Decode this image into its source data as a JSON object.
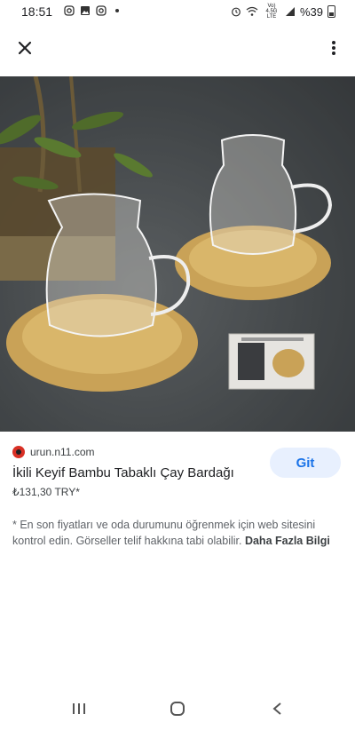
{
  "status": {
    "time": "18:51",
    "battery": "%39",
    "network": "Vo) 4.5G LTE"
  },
  "icons": {
    "close": "close-icon",
    "more": "more-vert-icon"
  },
  "result": {
    "source": "urun.n11.com",
    "title": "İkili Keyif Bambu Tabaklı Çay Bardağı",
    "price": "₺131,30 TRY*",
    "visit_label": "Git"
  },
  "disclaimer": {
    "text": "* En son fiyatları ve oda durumunu öğrenmek için web sitesini kontrol edin. Görseller telif hakkına tabi olabilir. ",
    "more_label": "Daha Fazla Bilgi"
  },
  "colors": {
    "accent": "#1a73e8",
    "button_bg": "#e8f0fe"
  }
}
